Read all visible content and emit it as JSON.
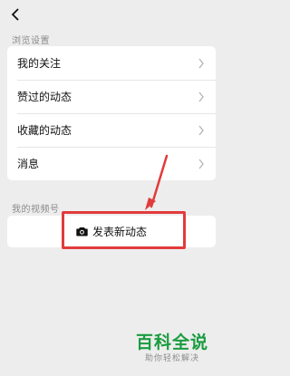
{
  "header": {
    "back_icon": "back-chevron-icon"
  },
  "browse_section": {
    "title": "浏览设置",
    "items": [
      {
        "label": "我的关注"
      },
      {
        "label": "赞过的动态"
      },
      {
        "label": "收藏的动态"
      },
      {
        "label": "消息"
      }
    ]
  },
  "channel_section": {
    "title": "我的视频号",
    "post_button_label": "发表新动态",
    "post_icon": "camera-icon"
  },
  "annotation": {
    "highlight_color": "#e23b3b"
  },
  "watermark": {
    "main": "百科全说",
    "sub": "助你轻松解决",
    "color": "#1a9c3f"
  }
}
